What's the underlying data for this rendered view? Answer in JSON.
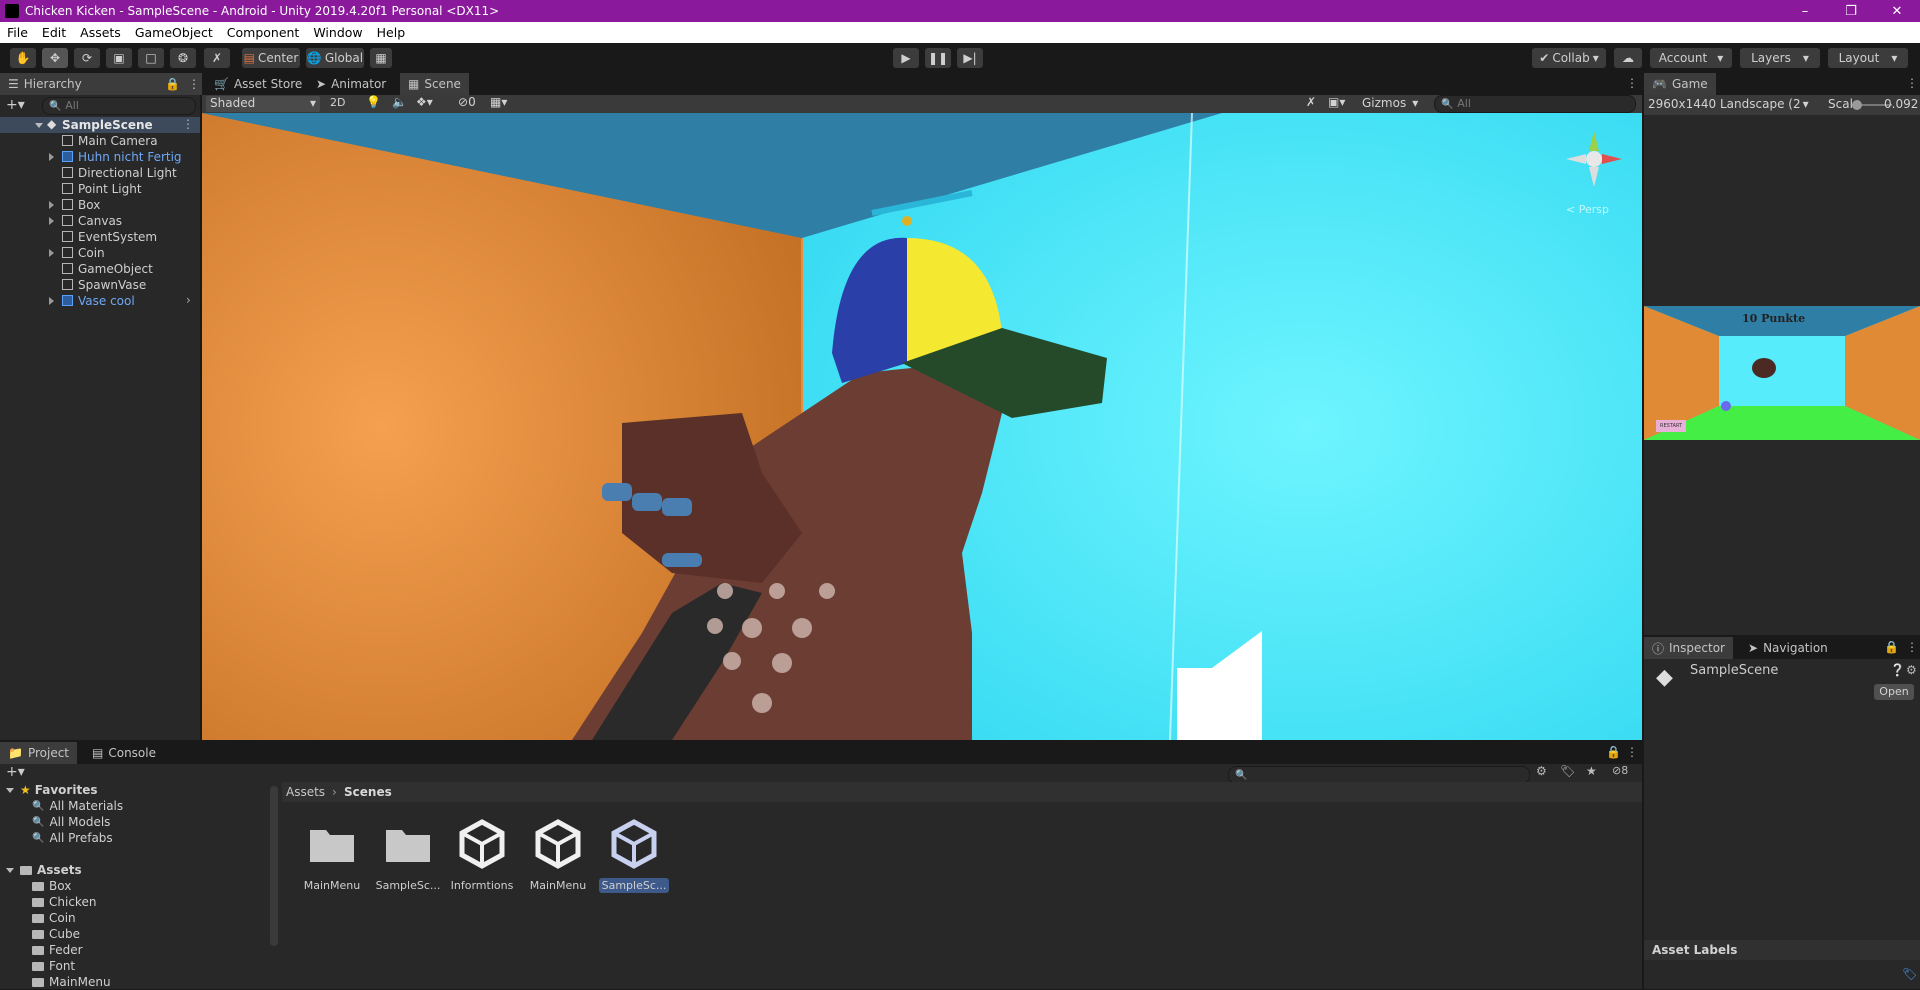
{
  "window": {
    "title": "Chicken Kicken - SampleScene - Android - Unity 2019.4.20f1 Personal <DX11>"
  },
  "menu": [
    "File",
    "Edit",
    "Assets",
    "GameObject",
    "Component",
    "Window",
    "Help"
  ],
  "toolbar": {
    "center": "Center",
    "global": "Global",
    "collab": "Collab",
    "account": "Account",
    "layers": "Layers",
    "layout": "Layout"
  },
  "hierarchy": {
    "tab": "Hierarchy",
    "search_placeholder": "All",
    "scene": "SampleScene",
    "items": [
      {
        "label": "Main Camera",
        "expand": false,
        "prefab": false
      },
      {
        "label": "Huhn nicht Fertig",
        "expand": true,
        "prefab": true
      },
      {
        "label": "Directional Light",
        "expand": false,
        "prefab": false
      },
      {
        "label": "Point Light",
        "expand": false,
        "prefab": false
      },
      {
        "label": "Box",
        "expand": true,
        "prefab": false
      },
      {
        "label": "Canvas",
        "expand": true,
        "prefab": false
      },
      {
        "label": "EventSystem",
        "expand": false,
        "prefab": false
      },
      {
        "label": "Coin",
        "expand": true,
        "prefab": false
      },
      {
        "label": "GameObject",
        "expand": false,
        "prefab": false
      },
      {
        "label": "SpawnVase",
        "expand": false,
        "prefab": false
      },
      {
        "label": "Vase cool",
        "expand": true,
        "prefab": true
      }
    ]
  },
  "center_tabs": [
    "Asset Store",
    "Animator",
    "Scene"
  ],
  "scene_toolbar": {
    "shading": "Shaded",
    "mode2d": "2D",
    "hidden_count": "0",
    "gizmos": "Gizmos",
    "search_placeholder": "All"
  },
  "gizmo": {
    "label": "< Persp"
  },
  "game": {
    "tab": "Game",
    "resolution": "2960x1440 Landscape (2",
    "scale_label": "Scale",
    "scale_value": "0.092",
    "overlay_points": "10 Punkte",
    "overlay_button": "RESTART"
  },
  "inspector": {
    "tabs": [
      "Inspector",
      "Navigation"
    ],
    "object": "SampleScene",
    "open_button": "Open",
    "asset_labels": "Asset Labels"
  },
  "project": {
    "tabs": [
      "Project",
      "Console"
    ],
    "favorites_label": "Favorites",
    "favorites": [
      "All Materials",
      "All Models",
      "All Prefabs"
    ],
    "assets_label": "Assets",
    "folders": [
      "Box",
      "Chicken",
      "Coin",
      "Cube",
      "Feder",
      "Font",
      "MainMenu"
    ],
    "breadcrumb": [
      "Assets",
      "Scenes"
    ],
    "hidden_count": "8",
    "items": [
      {
        "label": "MainMenu",
        "type": "folder"
      },
      {
        "label": "SampleSc...",
        "type": "folder"
      },
      {
        "label": "Informtions",
        "type": "scene"
      },
      {
        "label": "MainMenu",
        "type": "scene"
      },
      {
        "label": "SampleSc...",
        "type": "scene",
        "selected": true
      }
    ]
  }
}
